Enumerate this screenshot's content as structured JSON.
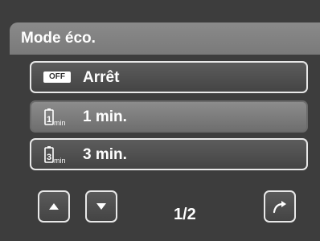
{
  "header": {
    "title": "Mode éco."
  },
  "menu": {
    "items": [
      {
        "icon": "off-icon",
        "icon_text": "OFF",
        "label": "Arrêt",
        "selected": false
      },
      {
        "icon": "battery-1min-icon",
        "icon_text": "min",
        "label": "1 min.",
        "selected": true
      },
      {
        "icon": "battery-3min-icon",
        "icon_text": "min",
        "label": "3 min.",
        "selected": false
      }
    ]
  },
  "footer": {
    "page_indicator": "1/2",
    "up_icon": "triangle-up-icon",
    "down_icon": "triangle-down-icon",
    "back_icon": "return-arrow-icon"
  }
}
